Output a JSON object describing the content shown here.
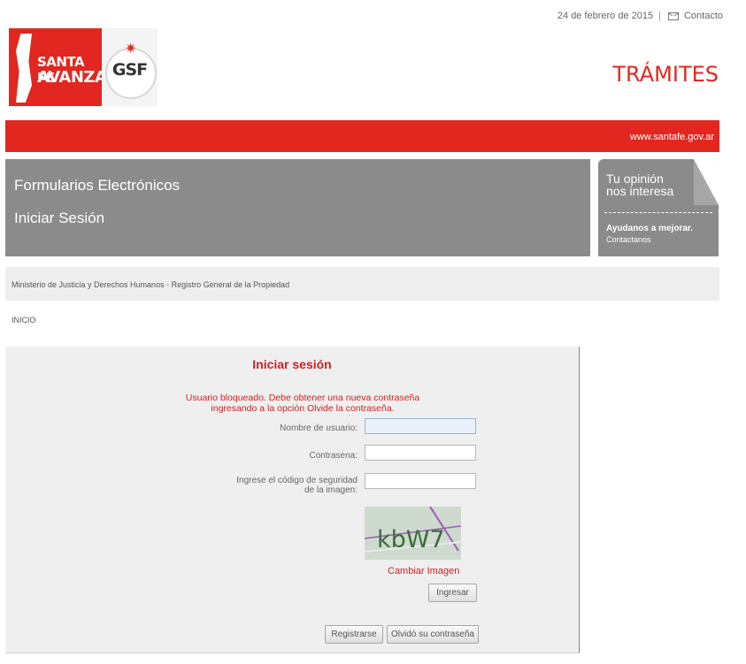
{
  "header": {
    "date": "24 de febrero de 2015",
    "separator": "|",
    "contact_label": "Contacto",
    "logo_line1": "SANTA FE",
    "logo_line2": "AVANZA",
    "gsf_logo": "GSF",
    "section_title": "TRÁMITES",
    "site_url": "www.santafe.gov.ar"
  },
  "banner": {
    "line1": "Formularios Electrónicos",
    "line2": "Iniciar Sesión"
  },
  "opinion": {
    "line1": "Tu opinión",
    "line2": "nos interesa",
    "line3": "Ayudanos a mejorar.",
    "line4": "Contactanos"
  },
  "breadcrumb": {
    "ministry": "Ministerio de Justicia y Derechos Humanos - Registro General de la Propiedad",
    "inicio": "INICIO"
  },
  "login": {
    "title": "Iniciar sesión",
    "error_line1": "Usuario bloqueado. Debe obtener una nueva contraseña",
    "error_line2": "ingresando a la opción Olvide la contraseña.",
    "username_label": "Nombre de usuario:",
    "username_value": "",
    "password_label": "Contrasena:",
    "password_value": "",
    "captcha_label_line1": "Ingrese el código de seguridad",
    "captcha_label_line2": "de la imagen:",
    "captcha_value": "",
    "captcha_text": "kbW7",
    "change_image": "Cambiar Imagen",
    "submit": "Ingresar",
    "register": "Registrarse",
    "forgot": "Olvidó su contraseña"
  },
  "colors": {
    "brand_red": "#e1271f",
    "banner_gray": "#8b8b8b",
    "error_red": "#d02020"
  }
}
